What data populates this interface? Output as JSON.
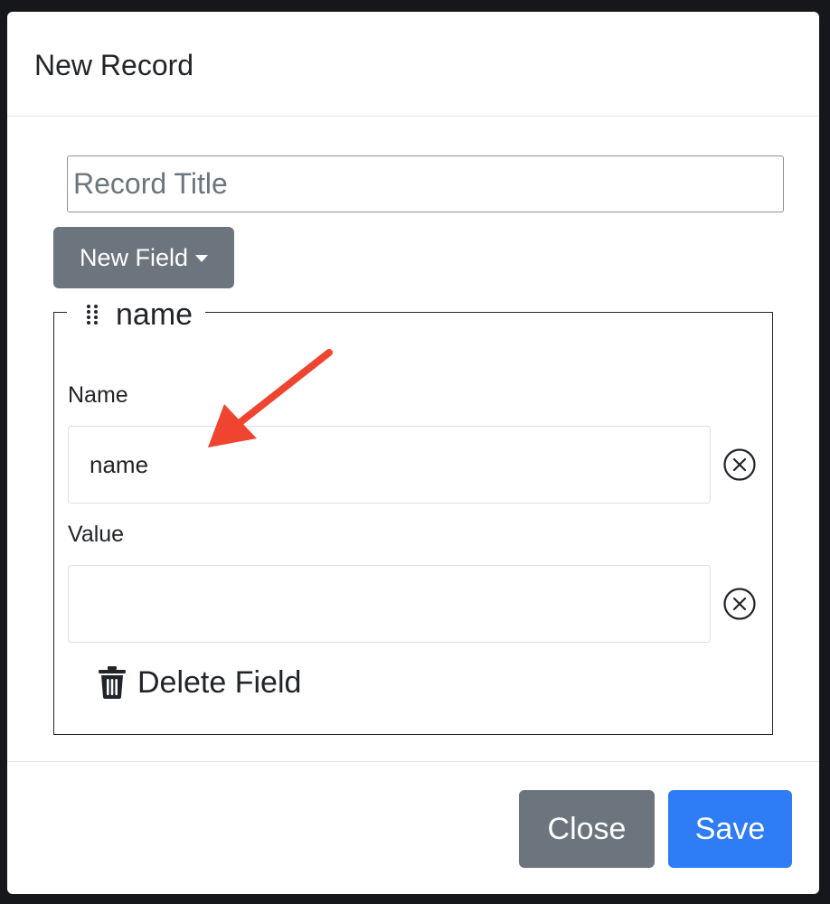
{
  "modal": {
    "title": "New Record",
    "record_title_placeholder": "Record Title",
    "new_field_label": "New Field",
    "field": {
      "legend": "name",
      "name_label": "Name",
      "name_value": "name",
      "value_label": "Value",
      "value_value": "",
      "delete_label": "Delete Field"
    },
    "footer": {
      "close_label": "Close",
      "save_label": "Save"
    }
  },
  "colors": {
    "primary": "#2e7cf6",
    "secondary": "#6c757d",
    "annotation_arrow": "#ee4430"
  },
  "icons": {
    "drag_handle": "drag-handle-icon",
    "caret": "caret-down-icon",
    "clear": "circle-x-icon",
    "trash": "trash-icon"
  }
}
